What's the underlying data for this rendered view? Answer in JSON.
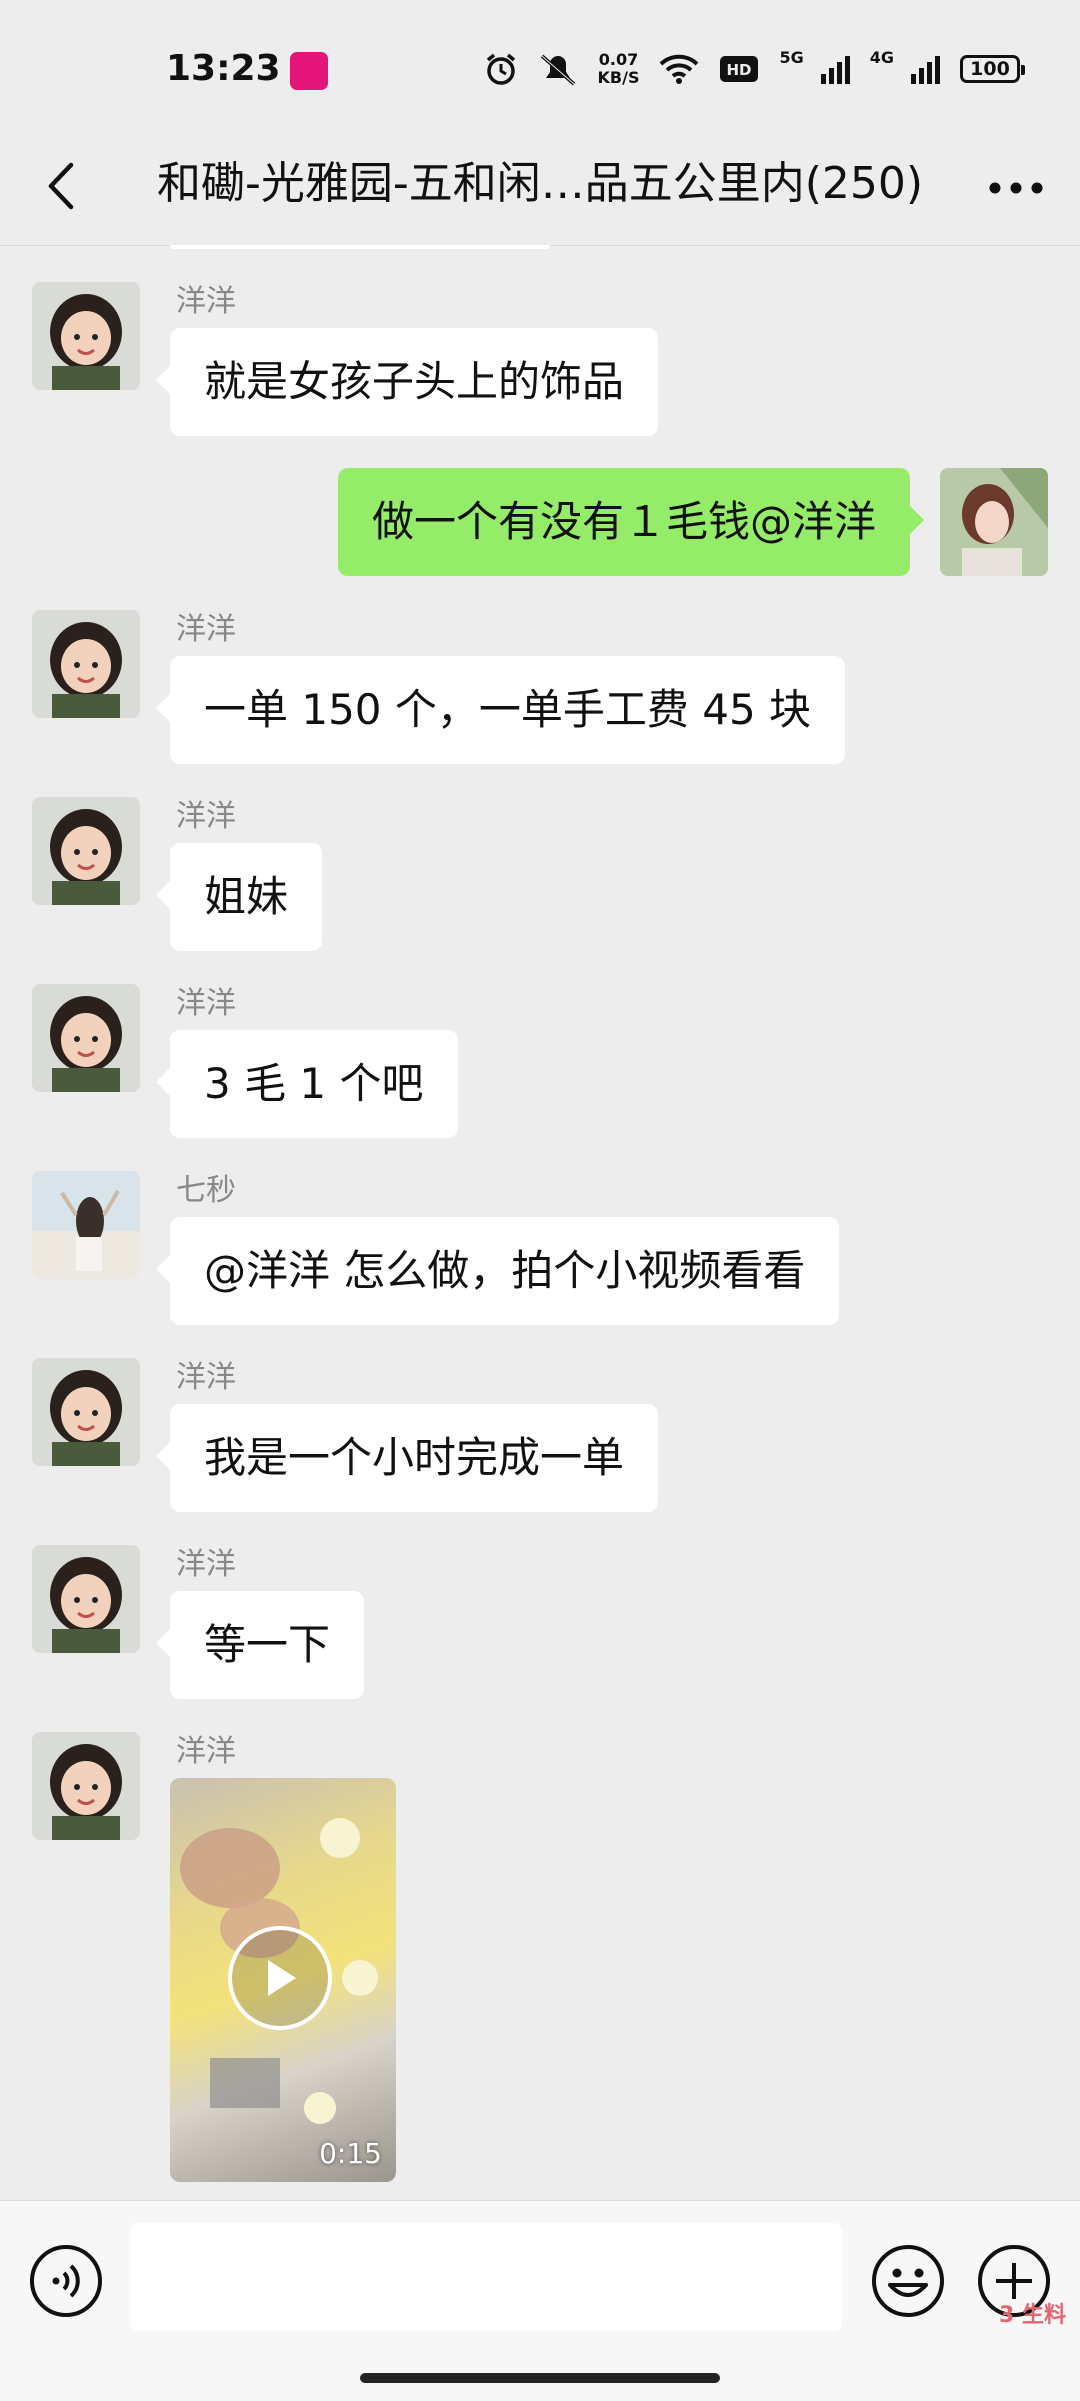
{
  "status_bar": {
    "time": "13:23",
    "net_speed_value": "0.07",
    "net_speed_unit": "KB/S",
    "network_1": "5G",
    "network_2": "4G",
    "battery": "100",
    "icons": [
      "alarm-icon",
      "mute-icon",
      "wifi-icon",
      "hd-icon",
      "signal-icon",
      "battery-icon"
    ]
  },
  "header": {
    "title": "和磡-光雅园-五和闲…品五公里内(250)",
    "back_icon": "chevron-left-icon",
    "more_icon": "more-icon"
  },
  "messages": [
    {
      "sender": "洋洋",
      "text": "就是女孩子头上的饰品"
    },
    {
      "sender": "",
      "text": "做一个有没有１毛钱@洋洋",
      "outgoing": true
    },
    {
      "sender": "洋洋",
      "text": "一单 150 个，一单手工费 45 块"
    },
    {
      "sender": "洋洋",
      "text": "姐妹"
    },
    {
      "sender": "洋洋",
      "text": "3 毛 1 个吧"
    },
    {
      "sender": "七秒",
      "text": "@洋洋  怎么做，拍个小视频看看"
    },
    {
      "sender": "洋洋",
      "text": "我是一个小时完成一单"
    },
    {
      "sender": "洋洋",
      "text": "等一下"
    },
    {
      "sender": "洋洋",
      "video_duration": "0:15"
    }
  ],
  "input_bar": {
    "placeholder": "",
    "watermark": "3 生料"
  },
  "colors": {
    "background": "#ededed",
    "incoming_bubble": "#ffffff",
    "outgoing_bubble": "#95ec69",
    "status_app_icon": "#e6157a"
  }
}
